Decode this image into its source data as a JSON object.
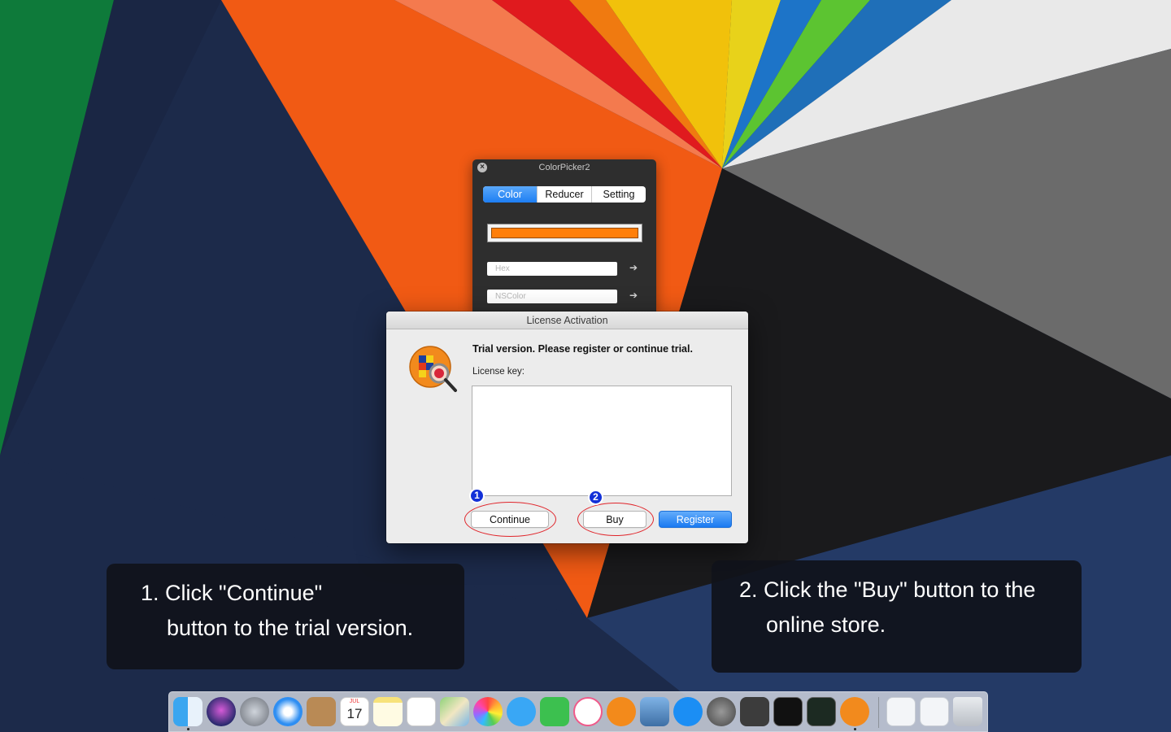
{
  "colorpicker": {
    "title": "ColorPicker2",
    "tabs": [
      "Color",
      "Reducer",
      "Setting"
    ],
    "active_tab": "Color",
    "current_color": "#FF7F0A",
    "hex_placeholder": "Hex",
    "nscolor_placeholder": "NSColor"
  },
  "dialog": {
    "title": "License Activation",
    "heading": "Trial version. Please register or continue trial.",
    "license_label": "License key:",
    "license_value": "",
    "buttons": {
      "continue": "Continue",
      "buy": "Buy",
      "register": "Register"
    }
  },
  "annotations": {
    "badge1": "1",
    "badge2": "2",
    "callout1": {
      "line1": "1. Click \"Continue\"",
      "line2": "button to the trial version."
    },
    "callout2": {
      "line1": "2. Click the \"Buy\" button to the",
      "line2": "online store."
    }
  },
  "dock": {
    "calendar_month": "JUL",
    "calendar_day": "17",
    "items": [
      "Finder",
      "Siri",
      "Launchpad",
      "Safari",
      "Contacts",
      "Calendar",
      "Notes",
      "Reminders",
      "Maps",
      "Photos",
      "Messages",
      "FaceTime",
      "iTunes",
      "iBooks",
      "Preview",
      "App Store",
      "System Preferences",
      "Sublime Text",
      "Terminal",
      "Activity Monitor",
      "ColorPicker2",
      "Downloads stack",
      "Documents stack",
      "Trash"
    ]
  },
  "colors": {
    "accent_blue": "#1D7EF3",
    "annotation_red": "#E0252B",
    "badge_blue": "#1230D8",
    "wallpaper_orange": "#F15A14",
    "wallpaper_navy": "#1C2A4A"
  }
}
